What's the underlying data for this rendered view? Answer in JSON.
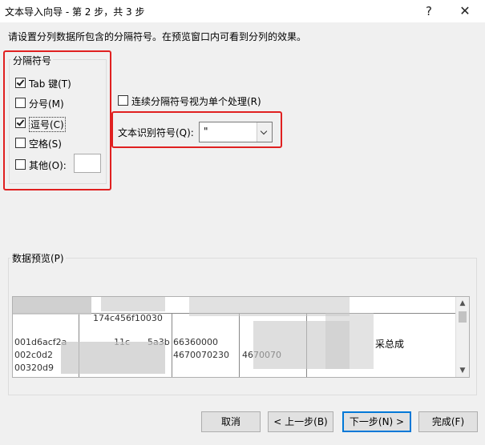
{
  "window": {
    "title": "文本导入向导 - 第 2 步，共 3 步",
    "help_label": "?",
    "close_label": "✕"
  },
  "instruction": "请设置分列数据所包含的分隔符号。在预览窗口内可看到分列的效果。",
  "delimiters": {
    "legend": "分隔符号",
    "items": [
      {
        "label": "Tab 键(T)",
        "checked": true
      },
      {
        "label": "分号(M)",
        "checked": false
      },
      {
        "label": "逗号(C)",
        "checked": true
      },
      {
        "label": "空格(S)",
        "checked": false
      },
      {
        "label": "其他(O):",
        "checked": false
      }
    ],
    "other_value": ""
  },
  "consecutive": {
    "label": "连续分隔符号视为单个处理(R)",
    "checked": false
  },
  "qualifier": {
    "label": "文本识别符号(Q):",
    "value": "\""
  },
  "preview": {
    "legend": "数据预览(P)",
    "rows": [
      "",
      "001d6acf2a",
      "002c0d2",
      "00320d9"
    ],
    "header_fragment": "174c456f10030",
    "cells": {
      "r1c2": "11c",
      "r1c3": "5a3b",
      "r1c4": "66360000",
      "r1c6": "采总成",
      "r2c4": "4670070230",
      "r2c5": "4670070"
    }
  },
  "buttons": {
    "cancel": "取消",
    "prev": "< 上一步(B)",
    "next": "下一步(N) >",
    "finish": "完成(F)"
  },
  "icons": {
    "checkmark": "checkmark-icon",
    "dropdown": "chevron-down-icon",
    "scroll_up": "scroll-up-icon",
    "scroll_down": "scroll-down-icon"
  },
  "colors": {
    "annotation_red": "#e02020",
    "primary_border": "#0078d7"
  }
}
